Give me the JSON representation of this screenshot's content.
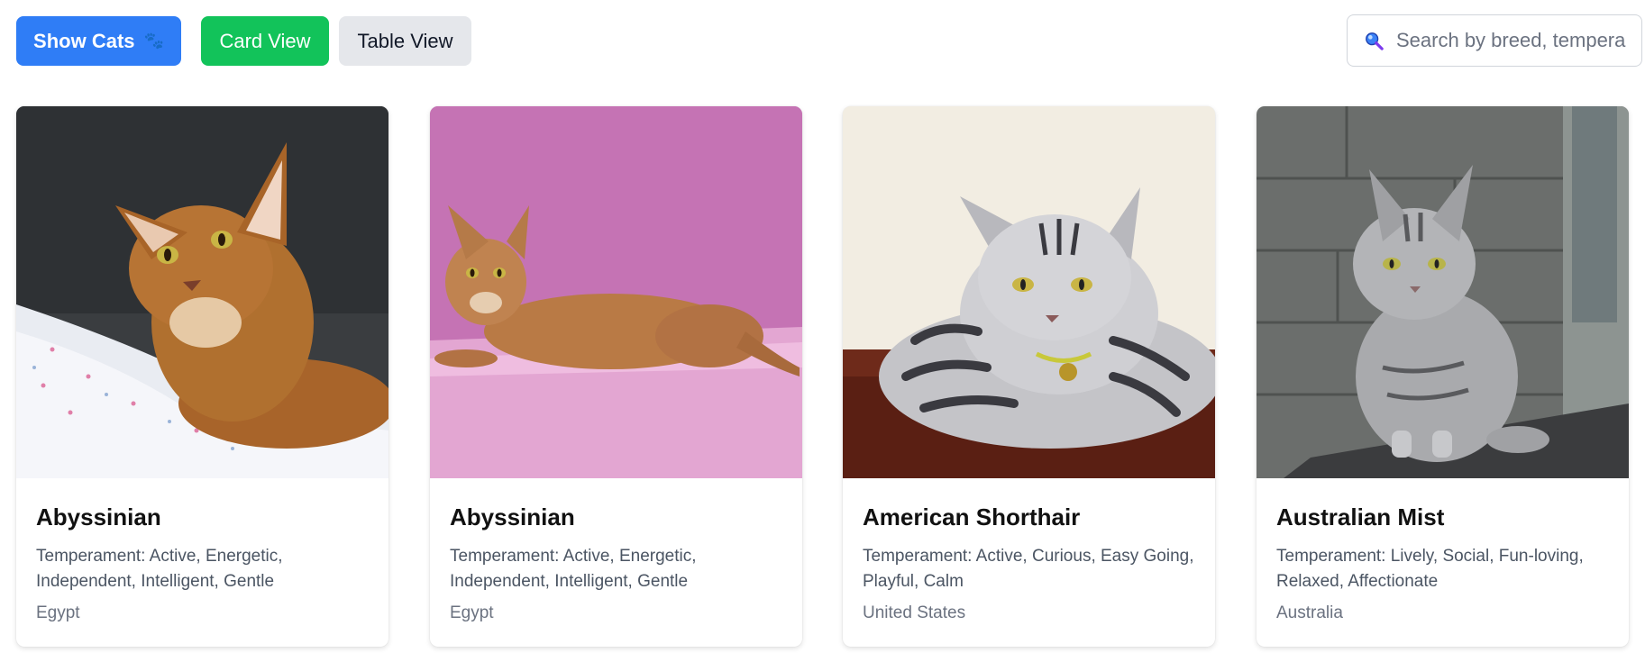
{
  "toolbar": {
    "show_cats_label": "Show Cats",
    "show_cats_icon": "paw-prints-icon",
    "card_view_label": "Card View",
    "table_view_label": "Table View"
  },
  "search": {
    "icon": "search-icon",
    "placeholder": "Search by breed, tempera",
    "value": ""
  },
  "colors": {
    "primary": "#2f7df6",
    "success": "#12c35a",
    "neutral": "#e5e7eb"
  },
  "cats": [
    {
      "name": "Abyssinian",
      "temperament": "Temperament: Active, Energetic, Independent, Intelligent, Gentle",
      "origin": "Egypt",
      "photo": "abyssinian-cat-lying-on-bed-photo"
    },
    {
      "name": "Abyssinian",
      "temperament": "Temperament: Active, Energetic, Independent, Intelligent, Gentle",
      "origin": "Egypt",
      "photo": "abyssinian-cat-on-pink-backdrop-photo"
    },
    {
      "name": "American Shorthair",
      "temperament": "Temperament: Active, Curious, Easy Going, Playful, Calm",
      "origin": "United States",
      "photo": "silver-tabby-shorthair-lying-photo"
    },
    {
      "name": "Australian Mist",
      "temperament": "Temperament: Lively, Social, Fun-loving, Relaxed, Affectionate",
      "origin": "Australia",
      "photo": "grey-tabby-sitting-on-ledge-photo"
    }
  ]
}
